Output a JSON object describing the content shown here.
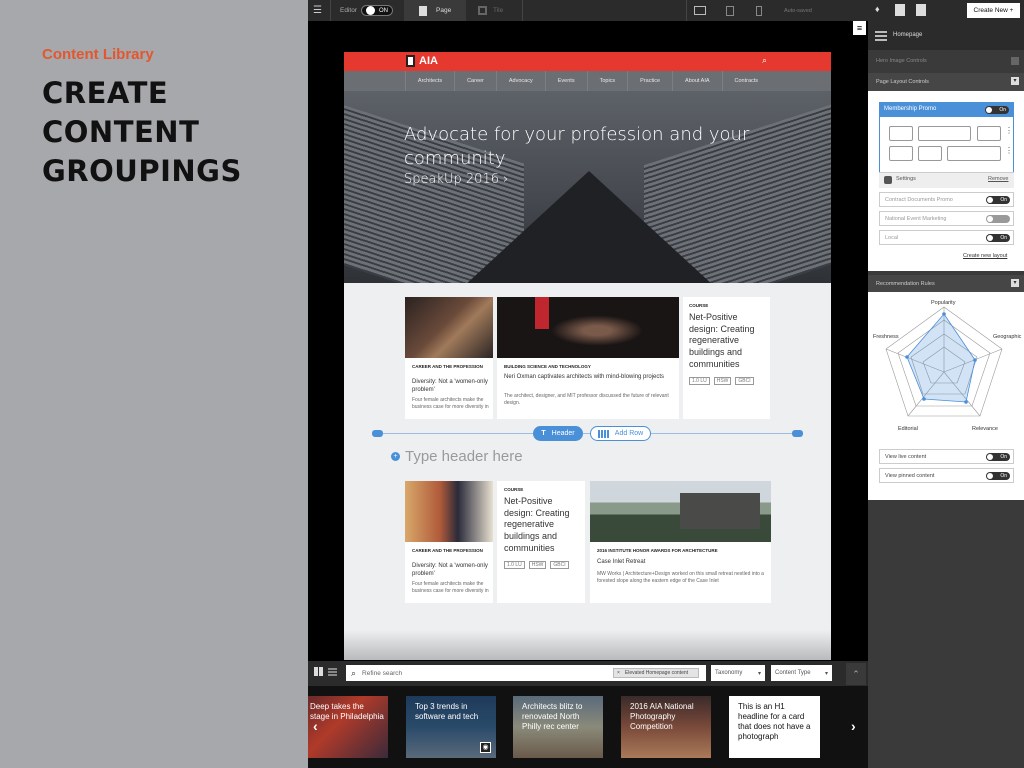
{
  "slide": {
    "eyebrow": "Content Library",
    "title_lines": [
      "CREATE",
      "CONTENT",
      "GROUPINGS"
    ]
  },
  "toolbar": {
    "editor_label": "Editor",
    "editor_toggle": "ON",
    "page_tab": "Page",
    "tile_tab": "Tile",
    "autosave": "Auto-saved"
  },
  "site": {
    "logo": "AIA",
    "nav": [
      "Architects",
      "Career",
      "Advocacy",
      "Events",
      "Topics",
      "Practice",
      "About AIA",
      "Contracts"
    ],
    "hero_line1": "Advocate for your profession and your",
    "hero_line2": "community",
    "hero_link": "SpeakUp 2016 ›"
  },
  "row1": {
    "c1": {
      "cat": "CAREER AND THE PROFESSION",
      "text": "Diversity: Not a 'women-only problem'",
      "sub": "Four female architects make the business case for more diversity in"
    },
    "c2": {
      "cat": "BUILDING SCIENCE AND TECHNOLOGY",
      "text": "Neri Oxman captivates architects with mind-blowing projects",
      "sub": "The architect, designer, and MIT professor discussed the future of relevant design."
    },
    "c3": {
      "cat": "COURSE",
      "big": "Net-Positive design: Creating regenerative buildings and communities",
      "tags": [
        "1.0 LU",
        "HSW",
        "GBCI"
      ]
    }
  },
  "row_controls": {
    "header_btn": "Header",
    "addrow_btn": "Add Row",
    "header_placeholder": "Type header here"
  },
  "row2": {
    "c1": {
      "cat": "CAREER AND THE PROFESSION",
      "text": "Diversity: Not a 'women-only problem'",
      "sub": "Four female architects make the business case for more diversity in"
    },
    "c2": {
      "cat": "COURSE",
      "big": "Net-Positive design: Creating regenerative buildings and communities",
      "tags": [
        "1.0 LU",
        "HSW",
        "GBCI"
      ]
    },
    "c3": {
      "cat": "2016 INSTITUTE HONOR AWARDS FOR ARCHITECTURE",
      "text": "Case Inlet Retreat",
      "sub": "MW Works | Architecture+Design worked on this small retreat nestled into a forested slope along the eastern edge of the Case Inlet"
    }
  },
  "filter": {
    "placeholder": "Refine search",
    "chip": "Elevated Homepage content",
    "taxonomy": "Taxonomy",
    "content_type": "Content Type"
  },
  "strip": [
    "Deep takes the stage in Philadelphia",
    "Top 3 trends in software and tech",
    "Architects blitz to renovated North Philly rec center",
    "2016 AIA National Photography Competition",
    "This is an H1 headline for a card that does not have a photograph"
  ],
  "panel": {
    "create_new": "Create New +",
    "homepage": "Homepage",
    "hero_controls": "Hero Image Controls",
    "layout_controls": "Page Layout Controls",
    "membership_promo": "Membership Promo",
    "on": "On",
    "settings": "Settings",
    "remove": "Remove",
    "items": [
      "Contract Documents Promo",
      "National Event Marketing",
      "Local"
    ],
    "create_layout": "Create new layout",
    "rec_rules": "Recommendation Rules",
    "radar_labels": [
      "Popularity",
      "Geographic",
      "Relevance",
      "Editorial",
      "Freshness"
    ],
    "view_live": "View live content",
    "view_pinned": "View pinned content"
  },
  "colors": {
    "accent": "#e4572e",
    "aia_red": "#e5382f",
    "blue": "#4a90d9"
  }
}
